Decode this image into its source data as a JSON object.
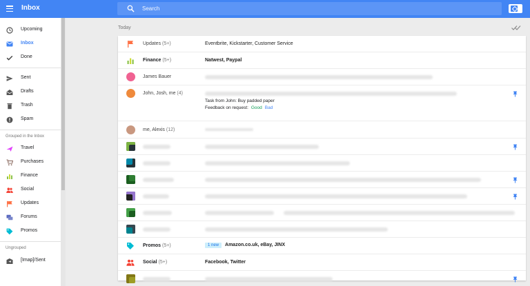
{
  "header": {
    "title": "Inbox",
    "search_placeholder": "Search",
    "menu_icon": "hamburger-icon",
    "search_icon": "search-icon",
    "pin_toggle_icon": "pin-toggle-icon"
  },
  "sidebar": {
    "primary": [
      {
        "label": "Upcoming",
        "icon": "clock-icon"
      },
      {
        "label": "Inbox",
        "icon": "mail-icon",
        "active": true
      },
      {
        "label": "Done",
        "icon": "check-icon"
      }
    ],
    "secondary": [
      {
        "label": "Sent",
        "icon": "send-icon"
      },
      {
        "label": "Drafts",
        "icon": "drafts-icon"
      },
      {
        "label": "Trash",
        "icon": "trash-icon"
      },
      {
        "label": "Spam",
        "icon": "spam-icon"
      }
    ],
    "grouped_heading": "Grouped in the Inbox",
    "grouped": [
      {
        "label": "Travel",
        "icon": "plane-icon",
        "color": "#e040fb"
      },
      {
        "label": "Purchases",
        "icon": "cart-icon",
        "color": "#8d6e63"
      },
      {
        "label": "Finance",
        "icon": "finance-icon",
        "color": "#8bc34a"
      },
      {
        "label": "Social",
        "icon": "people-icon",
        "color": "#f44336"
      },
      {
        "label": "Updates",
        "icon": "flag-icon",
        "color": "#ff7043"
      },
      {
        "label": "Forums",
        "icon": "forum-icon",
        "color": "#5c6bc0"
      },
      {
        "label": "Promos",
        "icon": "tag-icon",
        "color": "#00bcd4"
      }
    ],
    "ungrouped_heading": "Ungrouped",
    "ungrouped": [
      {
        "label": "[Imap]/Sent",
        "icon": "folder-send-icon"
      }
    ]
  },
  "main": {
    "section_label": "Today",
    "sweep_icon": "sweep-done-icon",
    "rows": [
      {
        "type": "bundle",
        "icon": "flag-icon",
        "sender": "Updates",
        "count": "(5+)",
        "subject": "Eventbrite, Kickstarter, Customer Service"
      },
      {
        "type": "bundle",
        "icon": "finance-icon",
        "sender": "Finance",
        "count": "(5+)",
        "subject": "Natwest, Paypal",
        "bold": true
      },
      {
        "type": "mail",
        "sender": "James Bauer"
      },
      {
        "type": "mail",
        "sender": "John, Josh, me",
        "count": "(4)",
        "task": "Task from John: Buy padded paper",
        "feedback_label": "Feedback on request:",
        "good": "Good",
        "bad": "Bad",
        "pinned": true
      },
      {
        "type": "mail",
        "sender": "me, Alexis",
        "count": "(12)"
      },
      {
        "type": "mail",
        "pinned": true
      },
      {
        "type": "mail"
      },
      {
        "type": "mail",
        "pinned": true
      },
      {
        "type": "mail",
        "pinned": true
      },
      {
        "type": "mail"
      },
      {
        "type": "mail"
      },
      {
        "type": "bundle",
        "icon": "tag-icon",
        "sender": "Promos",
        "count": "(5+)",
        "badge": "1 new",
        "subject": "Amazon.co.uk, eBay, JINX",
        "bold": true
      },
      {
        "type": "bundle",
        "icon": "people-icon",
        "sender": "Social",
        "count": "(5+)",
        "subject": "Facebook, Twitter",
        "bold": true
      },
      {
        "type": "mail",
        "pinned": true
      }
    ]
  },
  "colors": {
    "accent": "#4285f4",
    "search_bg": "#5c95f6",
    "background": "#ececec",
    "good": "#0f9d58",
    "pin": "#4285f4"
  }
}
